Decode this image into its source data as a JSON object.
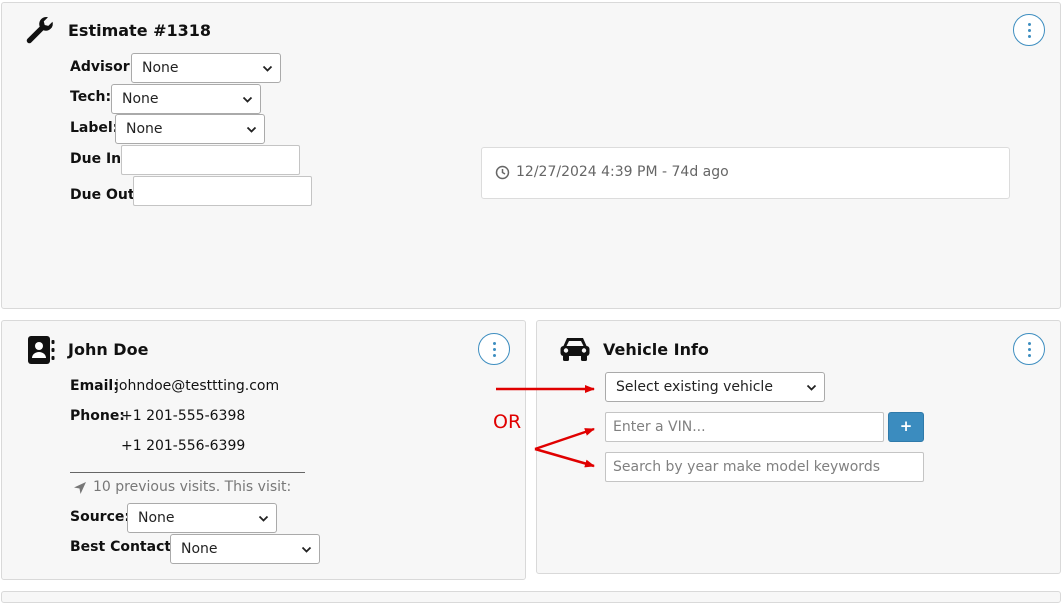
{
  "estimate": {
    "title": "Estimate #1318",
    "advisor_label": "Advisor:",
    "advisor_value": "None",
    "tech_label": "Tech:",
    "tech_value": "None",
    "label_label": "Label:",
    "label_value": "None",
    "due_in_label": "Due In:",
    "due_in_value": "",
    "due_out_label": "Due Out:",
    "due_out_value": "",
    "timestamp": "12/27/2024 4:39 PM - 74d ago",
    "icon": "wrench-icon"
  },
  "customer": {
    "name": "John Doe",
    "email_label": "Email:",
    "email": "johndoe@testtting.com",
    "phone_label": "Phone:",
    "phones": [
      "+1 201-555-6398",
      "+1 201-556-6399"
    ],
    "visits_text": "10 previous visits. This visit:",
    "source_label": "Source:",
    "source_value": "None",
    "best_contact_label": "Best Contact:",
    "best_contact_value": "None",
    "icon": "contact-card-icon"
  },
  "vehicle": {
    "title": "Vehicle Info",
    "select_placeholder": "Select existing vehicle",
    "vin_placeholder": "Enter a VIN...",
    "add_label": "+",
    "search_placeholder": "Search by year make model keywords",
    "icon": "car-icon"
  },
  "annotation": {
    "or_text": "OR",
    "arrow_color": "#e00000"
  },
  "colors": {
    "accent": "#3b8cbf",
    "card_bg": "#f7f7f7"
  }
}
